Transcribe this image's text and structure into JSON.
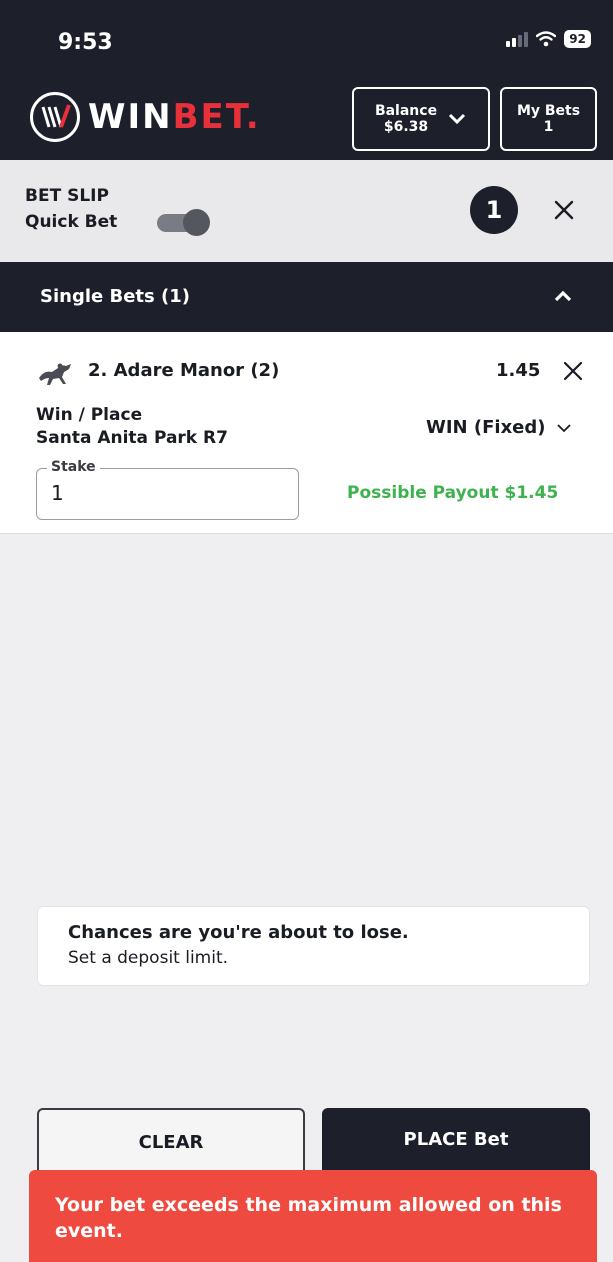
{
  "status_bar": {
    "time": "9:53",
    "battery": "92"
  },
  "header": {
    "brand_part1": "WIN",
    "brand_part2": "BET",
    "balance_label": "Balance",
    "balance_value": "$6.38",
    "my_bets_label": "My Bets",
    "my_bets_count": "1"
  },
  "bet_slip": {
    "title": "BET SLIP",
    "quick_bet_label": "Quick Bet",
    "quick_bet_enabled": true,
    "count": "1"
  },
  "single_bets": {
    "title": "Single Bets (1)"
  },
  "bet": {
    "selection": "2. Adare Manor (2)",
    "odds": "1.45",
    "bet_type": "Win / Place",
    "race": "Santa Anita Park R7",
    "option_selected": "WIN (Fixed)",
    "stake_label": "Stake",
    "stake_value": "1",
    "payout_text": "Possible Payout $1.45"
  },
  "responsible_gambling": {
    "title": "Chances are you're about to lose.",
    "subtitle": "Set a deposit limit."
  },
  "actions": {
    "clear_label": "CLEAR",
    "place_label": "PLACE Bet"
  },
  "error_toast": {
    "message": "Your bet exceeds the maximum allowed on this event."
  },
  "colors": {
    "header_bg": "#1d1f2b",
    "brand_red": "#e8303b",
    "payout_green": "#3fb24f",
    "error_red": "#ef4a3f"
  },
  "icons": [
    "signal-icon",
    "wifi-icon",
    "battery-icon",
    "winbet-logo-icon",
    "chevron-down-icon",
    "close-icon",
    "chevron-up-icon",
    "horse-racing-icon"
  ]
}
